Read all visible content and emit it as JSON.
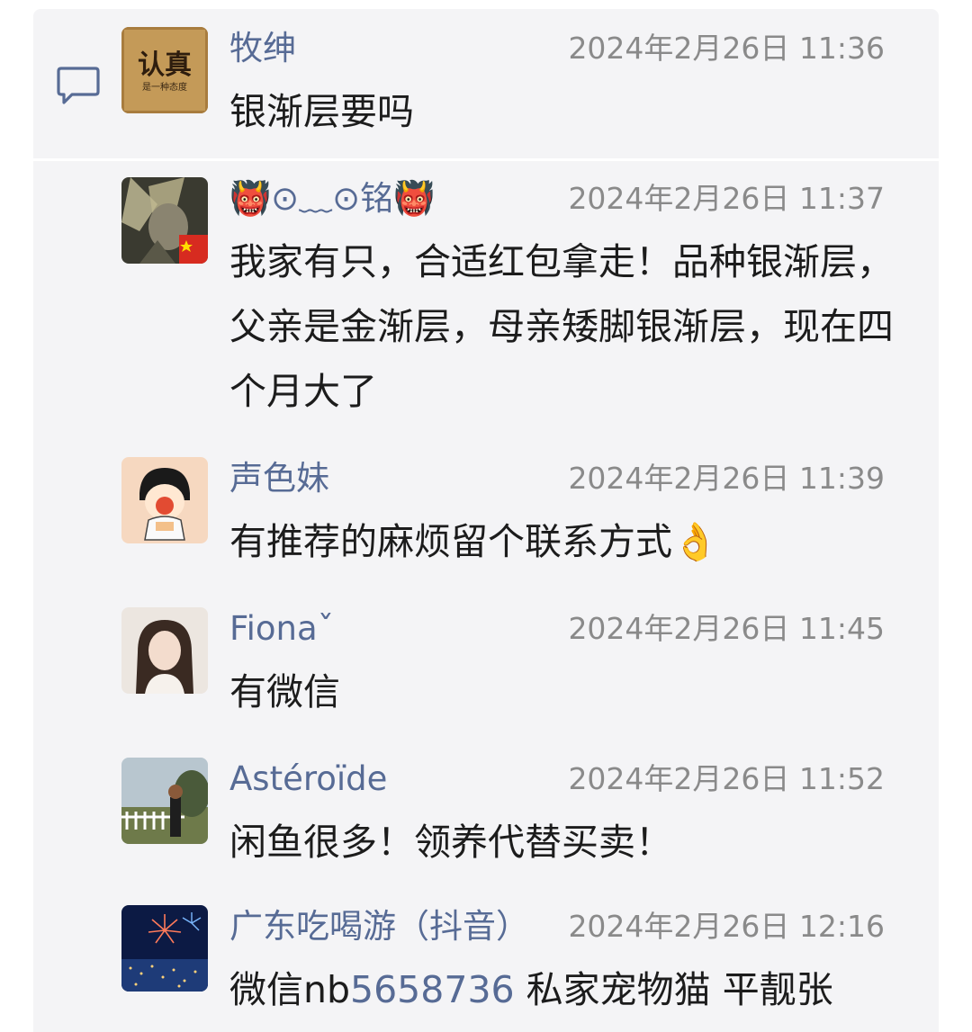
{
  "comments": [
    {
      "name": "牧绅",
      "time": "2024年2月26日 11:36",
      "text": "银渐层要吗",
      "avatar_text": "认真",
      "avatar_subtext": "是一种态度"
    },
    {
      "name": "👹⊙﹏⊙铭👹",
      "time": "2024年2月26日 11:37",
      "text": "我家有只，合适红包拿走！品种银渐层，父亲是金渐层，母亲矮脚银渐层，现在四个月大了",
      "avatar_badge": "china-flag-icon"
    },
    {
      "name": "声色妹",
      "time": "2024年2月26日 11:39",
      "text": "有推荐的麻烦留个联系方式",
      "emoji": "👌"
    },
    {
      "name": "Fionaˇ",
      "time": "2024年2月26日 11:45",
      "text": "有微信"
    },
    {
      "name": "Astéroïde",
      "time": "2024年2月26日 11:52",
      "text": "闲鱼很多！领养代替买卖！"
    },
    {
      "name": "广东吃喝游（抖音）",
      "time": "2024年2月26日 12:16",
      "text_prefix": "微信nb",
      "text_link": "5658736",
      "text_suffix": " 私家宠物猫 平靓张"
    }
  ],
  "colors": {
    "name": "#576b95",
    "time": "#8a8a8a",
    "body": "#1c1c1c",
    "panel": "#f4f4f6"
  }
}
